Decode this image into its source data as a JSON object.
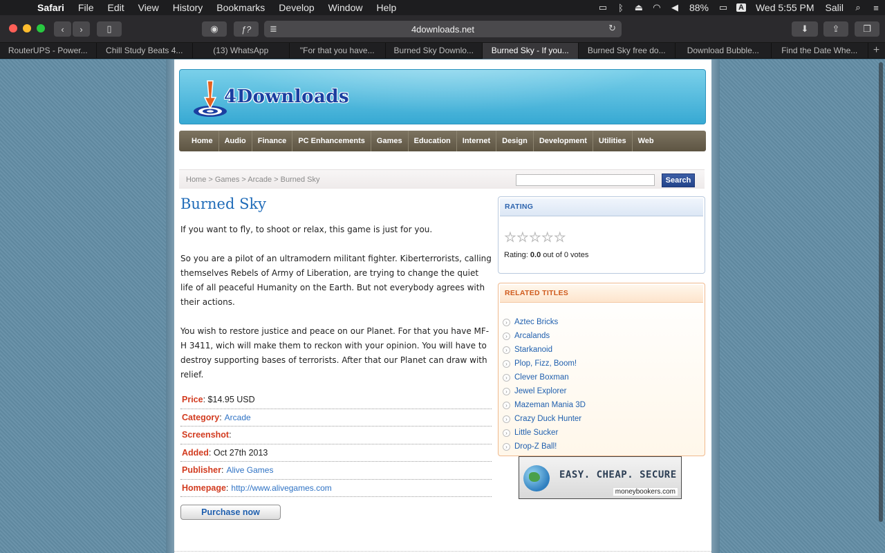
{
  "menubar": {
    "app": "Safari",
    "items": [
      "File",
      "Edit",
      "View",
      "History",
      "Bookmarks",
      "Develop",
      "Window",
      "Help"
    ],
    "battery": "88%",
    "clock": "Wed 5:55 PM",
    "user": "Salil",
    "input_source": "A"
  },
  "browser": {
    "url": "4downloads.net",
    "tabs": [
      "RouterUPS - Power...",
      "Chill Study Beats 4...",
      "(13) WhatsApp",
      "\"For that you have...",
      "Burned Sky Downlo...",
      "Burned Sky - If you...",
      "Burned Sky free do...",
      "Download Bubble...",
      "Find the Date Whe..."
    ],
    "active_tab_index": 5
  },
  "site": {
    "logo_text": "4Downloads",
    "nav": [
      "Home",
      "Audio",
      "Finance",
      "PC Enhancements",
      "Games",
      "Education",
      "Internet",
      "Design",
      "Development",
      "Utilities",
      "Web"
    ],
    "breadcrumb": "Home > Games > Arcade > Burned Sky",
    "search_button": "Search"
  },
  "product": {
    "title": "Burned Sky",
    "paragraphs": [
      "If you want to fly, to shoot or relax, this game is just for you.",
      "So you are a pilot of an ultramodern militant fighter. Kiberterrorists, calling themselves Rebels of Army of Liberation, are trying to change the quiet life of all peaceful Humanity on the Earth. But not everybody agrees with their actions.",
      "You wish to restore justice and peace on our Planet. For that you have MF-H 3411, wich will make them to reckon with your opinion. You will have to destroy supporting bases of terrorists. After that our Planet can draw with relief."
    ],
    "details": {
      "price_label": "Price",
      "price": "$14.95 USD",
      "category_label": "Category",
      "category": "Arcade",
      "screenshot_label": "Screenshot",
      "added_label": "Added",
      "added": "Oct 27th 2013",
      "publisher_label": "Publisher",
      "publisher": "Alive Games",
      "homepage_label": "Homepage",
      "homepage": "http://www.alivegames.com"
    },
    "purchase_label": "Purchase now"
  },
  "rating": {
    "heading": "RATING",
    "stars": "☆☆☆☆☆",
    "text_prefix": "Rating: ",
    "score": "0.0",
    "text_suffix": " out of 0 votes"
  },
  "related": {
    "heading": "RELATED TITLES",
    "items": [
      "Aztec Bricks",
      "Arcalands",
      "Starkanoid",
      "Plop, Fizz, Boom!",
      "Clever Boxman",
      "Jewel Explorer",
      "Mazeman Mania 3D",
      "Crazy Duck Hunter",
      "Little Sucker",
      "Drop-Z Ball!"
    ]
  },
  "ad": {
    "headline": "EASY. CHEAP. SECURE",
    "brand": "moneybookers.com"
  }
}
